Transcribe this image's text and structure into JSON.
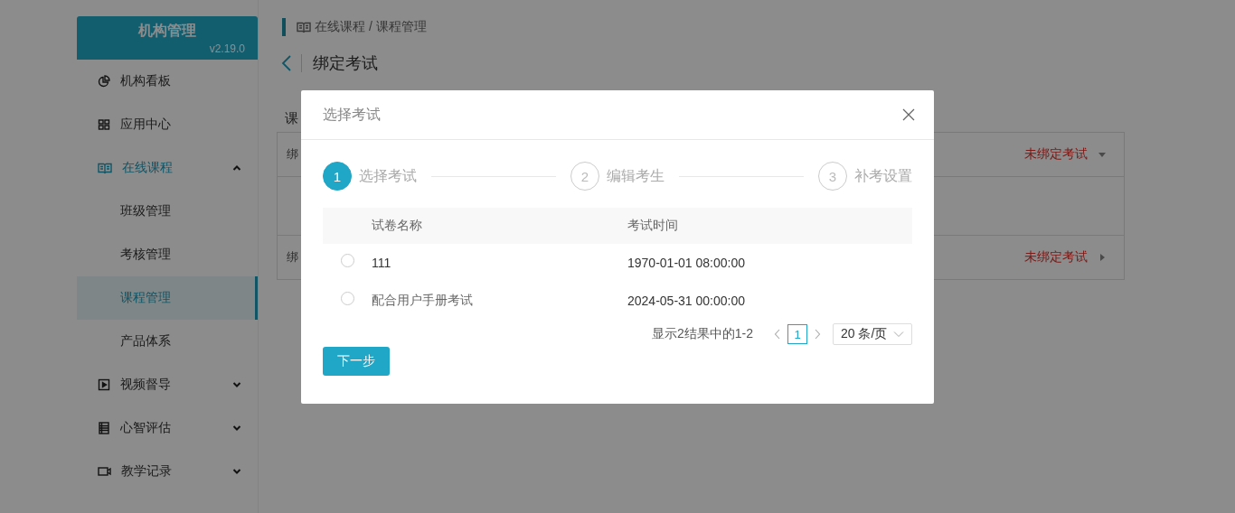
{
  "sidebar": {
    "title": "机构管理",
    "version": "v2.19.0",
    "items": [
      {
        "label": "机构看板",
        "selected": false
      },
      {
        "label": "应用中心",
        "selected": false
      },
      {
        "label": "在线课程",
        "selected": false,
        "expanded": true,
        "children": [
          {
            "label": "班级管理",
            "selected": false
          },
          {
            "label": "考核管理",
            "selected": false
          },
          {
            "label": "课程管理",
            "selected": true
          },
          {
            "label": "产品体系",
            "selected": false
          }
        ]
      },
      {
        "label": "视频督导",
        "selected": false,
        "expanded": false
      },
      {
        "label": "心智评估",
        "selected": false,
        "expanded": false
      },
      {
        "label": "教学记录",
        "selected": false,
        "expanded": false
      }
    ]
  },
  "breadcrumb": "在线课程 / 课程管理",
  "page_title": "绑定考试",
  "tab_fragment": "课",
  "panel_rows": [
    {
      "label": "绑",
      "status": "未绑定考试",
      "expanded": true
    },
    {
      "label": "绑",
      "status": "未绑定考试",
      "expanded": false
    }
  ],
  "dialog": {
    "title": "选择考试",
    "steps": [
      {
        "number": "1",
        "label": "选择考试",
        "selected": true
      },
      {
        "number": "2",
        "label": "编辑考生",
        "selected": false
      },
      {
        "number": "3",
        "label": "补考设置",
        "selected": false
      }
    ],
    "columns": [
      "试卷名称",
      "考试时间"
    ],
    "rows": [
      {
        "name": "111",
        "time": "1970-01-01 08:00:00",
        "selected": false
      },
      {
        "name": "配合用户手册考试",
        "time": "2024-05-31 00:00:00",
        "selected": false
      }
    ],
    "summary": "显示2结果中的1-2",
    "pages": [
      {
        "label": "1",
        "selected": true
      }
    ],
    "page_size": "20 条/页",
    "next_button": "下一步"
  }
}
